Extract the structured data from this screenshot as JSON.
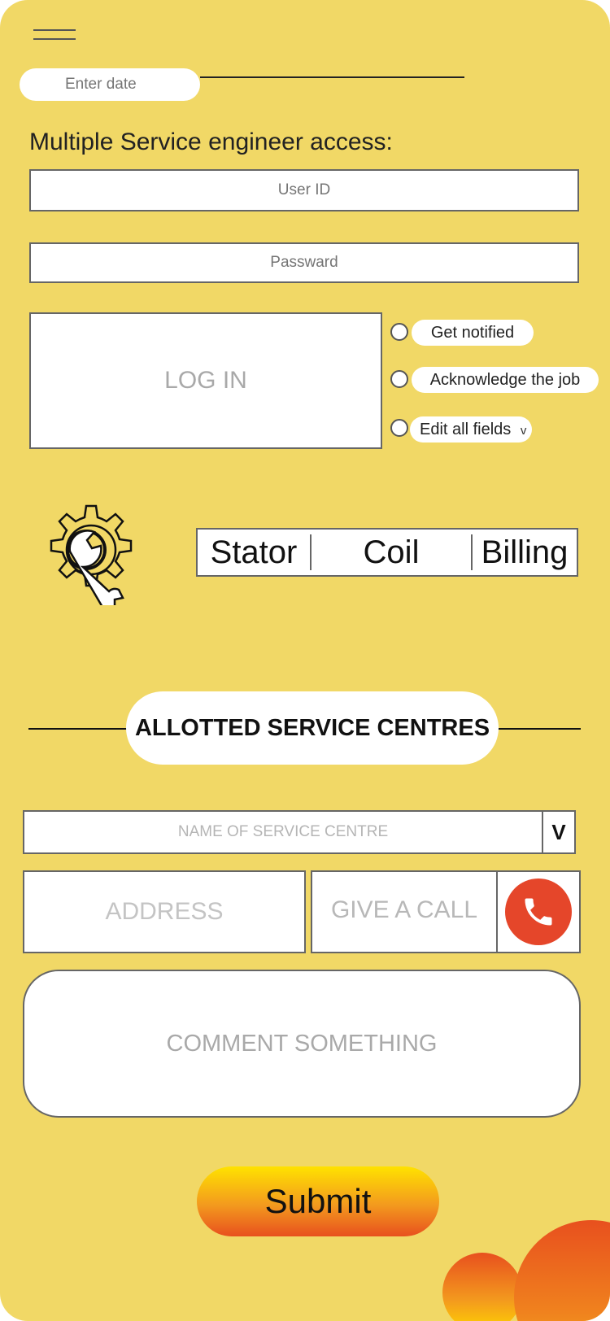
{
  "header": {
    "date_placeholder": "Enter date"
  },
  "login": {
    "section_title": "Multiple Service engineer access:",
    "user_id_placeholder": "User ID",
    "password_placeholder": "Passward",
    "login_label": "LOG IN",
    "options": [
      {
        "label": "Get notified"
      },
      {
        "label": "Acknowledge the job"
      },
      {
        "label": "Edit all fields",
        "dropdown_glyph": "v"
      }
    ]
  },
  "tabs": [
    {
      "label": "Stator"
    },
    {
      "label": "Coil"
    },
    {
      "label": "Billing"
    }
  ],
  "centres": {
    "title": "ALLOTTED SERVICE CENTRES",
    "name_placeholder": "NAME OF SERVICE CENTRE",
    "dropdown_glyph": "V",
    "address_placeholder": "ADDRESS",
    "call_label": "GIVE A CALL",
    "comment_placeholder": "COMMENT SOMETHING"
  },
  "submit_label": "Submit",
  "icons": {
    "menu": "hamburger-menu-icon",
    "settings": "gear-wrench-icon",
    "call": "phone-icon"
  },
  "colors": {
    "background": "#F1D866",
    "call_button": "#E5462A",
    "submit_gradient_top": "#FFE200",
    "submit_gradient_bottom": "#E8501E"
  }
}
